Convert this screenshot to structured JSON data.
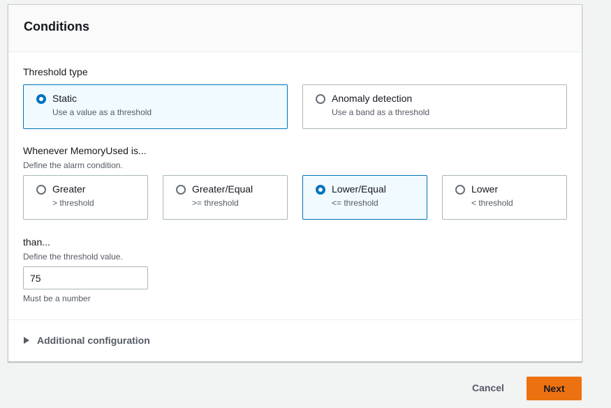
{
  "panel": {
    "title": "Conditions"
  },
  "threshold_type": {
    "label": "Threshold type",
    "options": [
      {
        "label": "Static",
        "description": "Use a value as a threshold",
        "selected": true
      },
      {
        "label": "Anomaly detection",
        "description": "Use a band as a threshold",
        "selected": false
      }
    ]
  },
  "condition": {
    "label": "Whenever MemoryUsed is...",
    "description": "Define the alarm condition.",
    "options": [
      {
        "label": "Greater",
        "description": "> threshold",
        "selected": false
      },
      {
        "label": "Greater/Equal",
        "description": ">= threshold",
        "selected": false
      },
      {
        "label": "Lower/Equal",
        "description": "<= threshold",
        "selected": true
      },
      {
        "label": "Lower",
        "description": "< threshold",
        "selected": false
      }
    ]
  },
  "threshold_value": {
    "label": "than...",
    "description": "Define the threshold value.",
    "value": "75",
    "constraint": "Must be a number"
  },
  "additional": {
    "label": "Additional configuration"
  },
  "footer": {
    "cancel_label": "Cancel",
    "next_label": "Next"
  },
  "colors": {
    "accent": "#0073bb",
    "primary_button": "#ec7211",
    "selected_tile_bg": "#f1faff"
  },
  "icons": {
    "expander": "caret-right-icon",
    "radio_checked": "radio-checked-icon",
    "radio_unchecked": "radio-unchecked-icon"
  }
}
